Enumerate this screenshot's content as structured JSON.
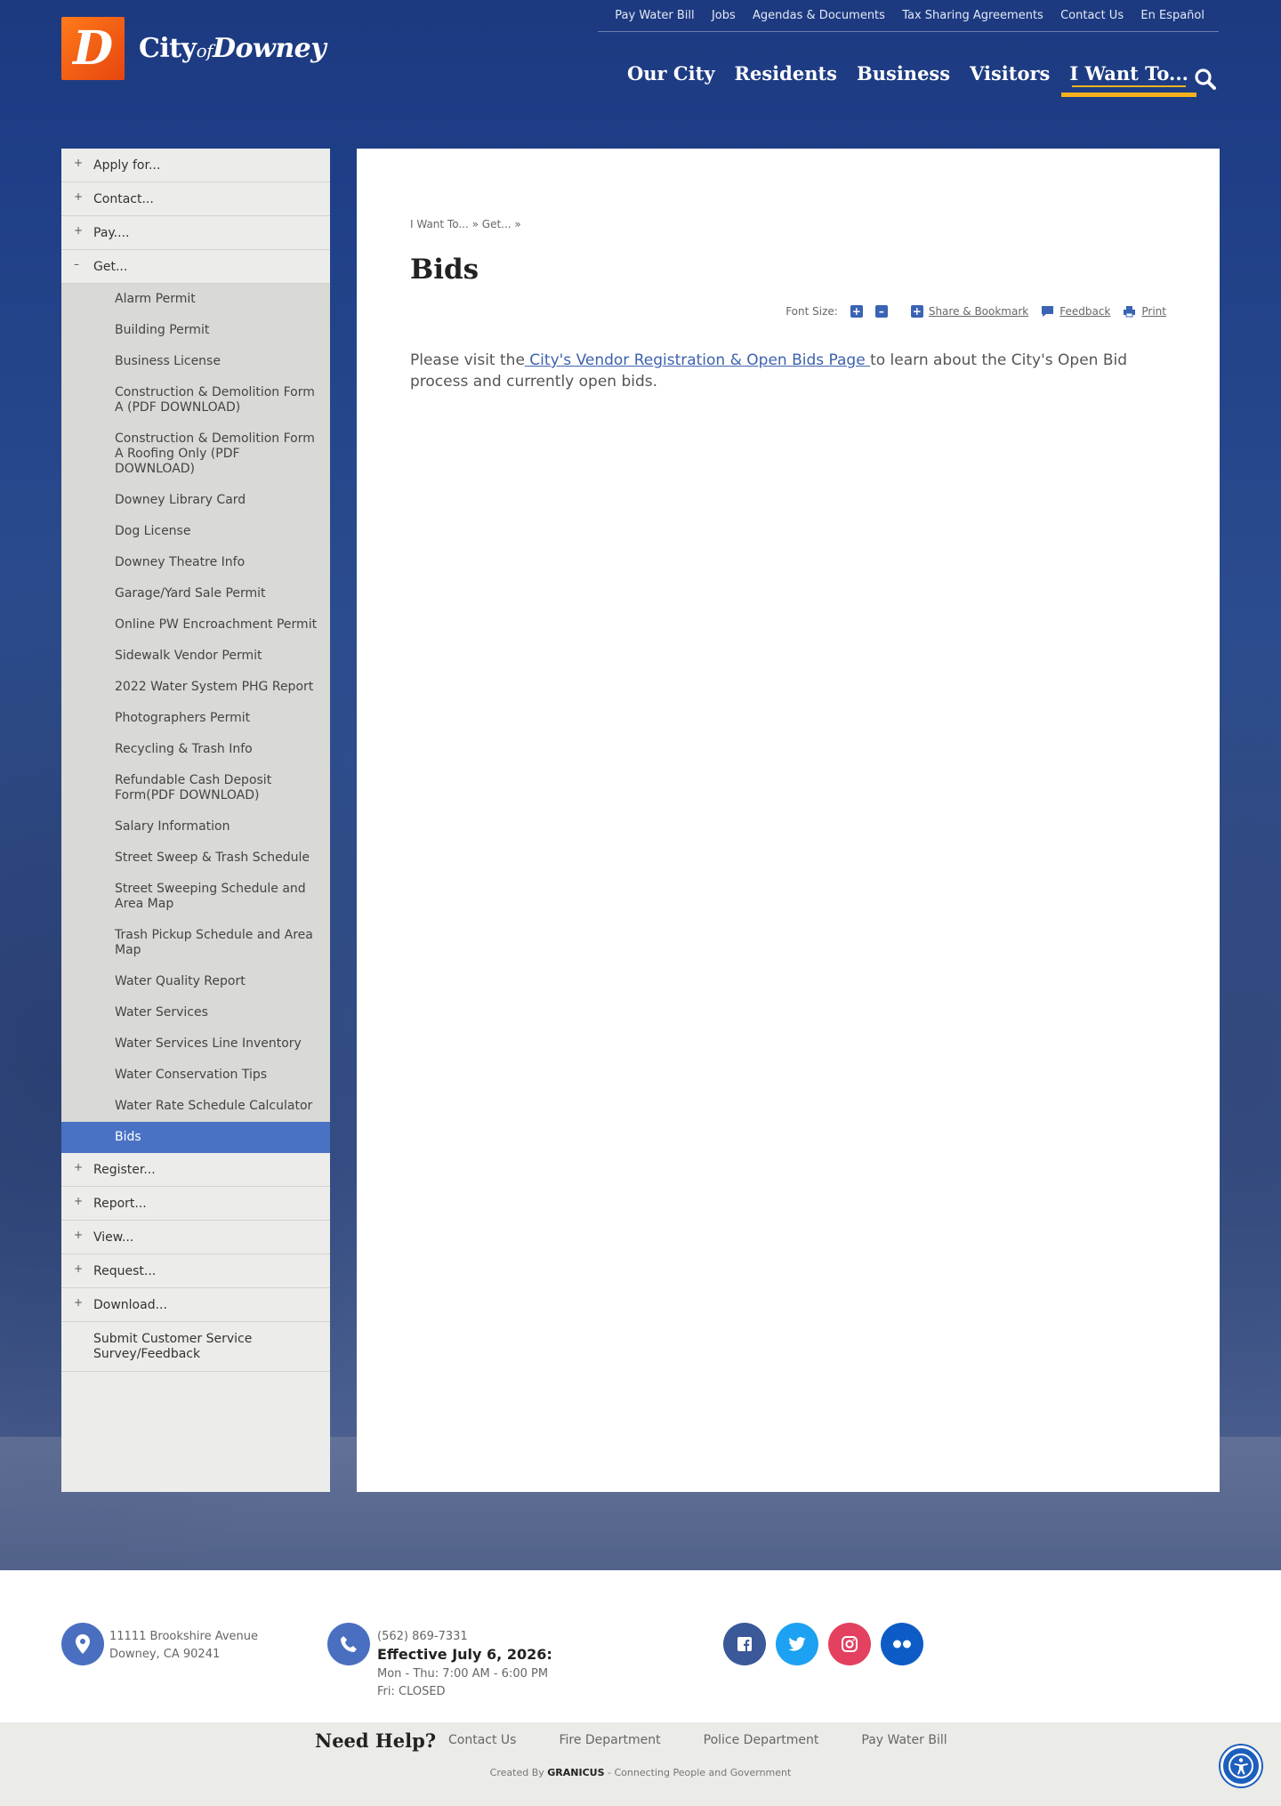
{
  "brand": {
    "logo_letter": "D",
    "city": "City",
    "of": "of",
    "name": "Downey"
  },
  "utility_nav": [
    "Pay Water Bill",
    "Jobs",
    "Agendas & Documents",
    "Tax Sharing Agreements",
    "Contact Us",
    "En Español"
  ],
  "main_nav": [
    "Our City",
    "Residents",
    "Business",
    "Visitors",
    "I Want To..."
  ],
  "sidebar": {
    "top_before": [
      {
        "sign": "+",
        "label": "Apply for..."
      },
      {
        "sign": "+",
        "label": "Contact..."
      },
      {
        "sign": "+",
        "label": "Pay...."
      },
      {
        "sign": "–",
        "label": "Get..."
      }
    ],
    "sub_items": [
      "Alarm Permit",
      "Building Permit",
      "Business License",
      "Construction & Demolition Form A (PDF DOWNLOAD)",
      "Construction & Demolition Form A Roofing Only (PDF DOWNLOAD)",
      "Downey Library Card",
      "Dog License",
      "Downey Theatre Info",
      "Garage/Yard Sale Permit",
      "Online PW Encroachment Permit",
      "Sidewalk Vendor Permit",
      "2022 Water System PHG Report",
      "Photographers Permit",
      "Recycling & Trash Info",
      "Refundable Cash Deposit Form(PDF DOWNLOAD)",
      "Salary Information",
      "Street Sweep & Trash Schedule",
      "Street Sweeping Schedule and Area Map",
      "Trash Pickup Schedule and Area Map",
      "Water Quality Report",
      "Water Services",
      "Water Services Line Inventory",
      "Water Conservation Tips",
      "Water Rate Schedule Calculator",
      "Bids"
    ],
    "top_after": [
      {
        "sign": "+",
        "label": "Register..."
      },
      {
        "sign": "+",
        "label": "Report..."
      },
      {
        "sign": "+",
        "label": "View..."
      },
      {
        "sign": "+",
        "label": "Request..."
      },
      {
        "sign": "+",
        "label": "Download..."
      },
      {
        "sign": "",
        "label": "Submit Customer Service Survey/Feedback"
      }
    ]
  },
  "content": {
    "breadcrumb": "I Want To... » Get... »",
    "title": "Bids",
    "font_size_label": "Font Size:",
    "share_label": "Share & Bookmark",
    "feedback_label": "Feedback",
    "print_label": "Print",
    "body_before": "Please visit the",
    "body_link": " City's Vendor Registration & Open Bids Page ",
    "body_after": "to learn about the City's  Open Bid process and currently open bids."
  },
  "footer": {
    "address_line1": "11111 Brookshire Avenue",
    "address_line2": "Downey, CA 90241",
    "phone": "(562) 869-7331",
    "effective": "Effective July 6, 2026:",
    "hours1": "Mon - Thu: 7:00 AM - 6:00 PM",
    "hours2": "Fri: CLOSED",
    "need_help": "Need Help?",
    "help_links": [
      "Contact Us",
      "Fire Department",
      "Police Department",
      "Pay Water Bill"
    ],
    "credit_prefix": "Created By",
    "credit_brand": "GRANICUS",
    "credit_suffix": "- Connecting People and Government"
  },
  "colors": {
    "brand_blue": "#1e3a7d",
    "accent": "#f5b21b",
    "active_item": "#4a72c4",
    "logo_orange": "#f0571a"
  }
}
